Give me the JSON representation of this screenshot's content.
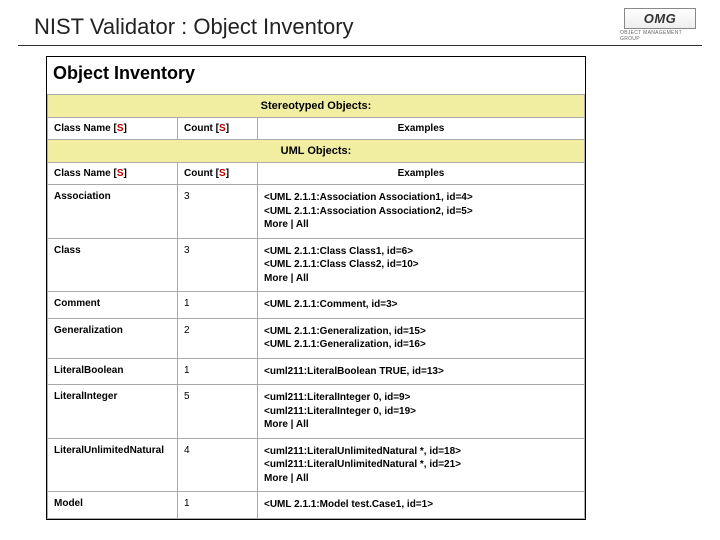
{
  "slide_title": "NIST Validator : Object Inventory",
  "logo": {
    "main": "OMG",
    "sub": "OBJECT MANAGEMENT GROUP"
  },
  "panel_heading": "Object Inventory",
  "sections": {
    "stereotyped": "Stereotyped Objects:",
    "uml": "UML Objects:"
  },
  "cols": {
    "class_name": "Class Name",
    "count": "Count",
    "examples": "Examples",
    "sort_open": "[",
    "sort_s": "S",
    "sort_close": "]"
  },
  "links": {
    "more": "More",
    "all": "All",
    "sep": " | "
  },
  "rows": [
    {
      "name": "Association",
      "count": "3",
      "examples": [
        "<UML 2.1.1:Association Association1, id=4>",
        "<UML 2.1.1:Association Association2, id=5>"
      ],
      "more_all": true
    },
    {
      "name": "Class",
      "count": "3",
      "examples": [
        "<UML 2.1.1:Class Class1, id=6>",
        "<UML 2.1.1:Class Class2, id=10>"
      ],
      "more_all": true
    },
    {
      "name": "Comment",
      "count": "1",
      "examples": [
        "<UML 2.1.1:Comment, id=3>"
      ],
      "more_all": false
    },
    {
      "name": "Generalization",
      "count": "2",
      "examples": [
        "<UML 2.1.1:Generalization, id=15>",
        "<UML 2.1.1:Generalization, id=16>"
      ],
      "more_all": false
    },
    {
      "name": "LiteralBoolean",
      "count": "1",
      "examples": [
        "<uml211:LiteralBoolean TRUE, id=13>"
      ],
      "more_all": false
    },
    {
      "name": "LiteralInteger",
      "count": "5",
      "examples": [
        "<uml211:LiteralInteger 0, id=9>",
        "<uml211:LiteralInteger 0, id=19>"
      ],
      "more_all": true
    },
    {
      "name": "LiteralUnlimitedNatural",
      "count": "4",
      "examples": [
        "<uml211:LiteralUnlimitedNatural *, id=18>",
        "<uml211:LiteralUnlimitedNatural *, id=21>"
      ],
      "more_all": true
    },
    {
      "name": "Model",
      "count": "1",
      "examples": [
        "<UML 2.1.1:Model test.Case1, id=1>"
      ],
      "more_all": false
    }
  ]
}
